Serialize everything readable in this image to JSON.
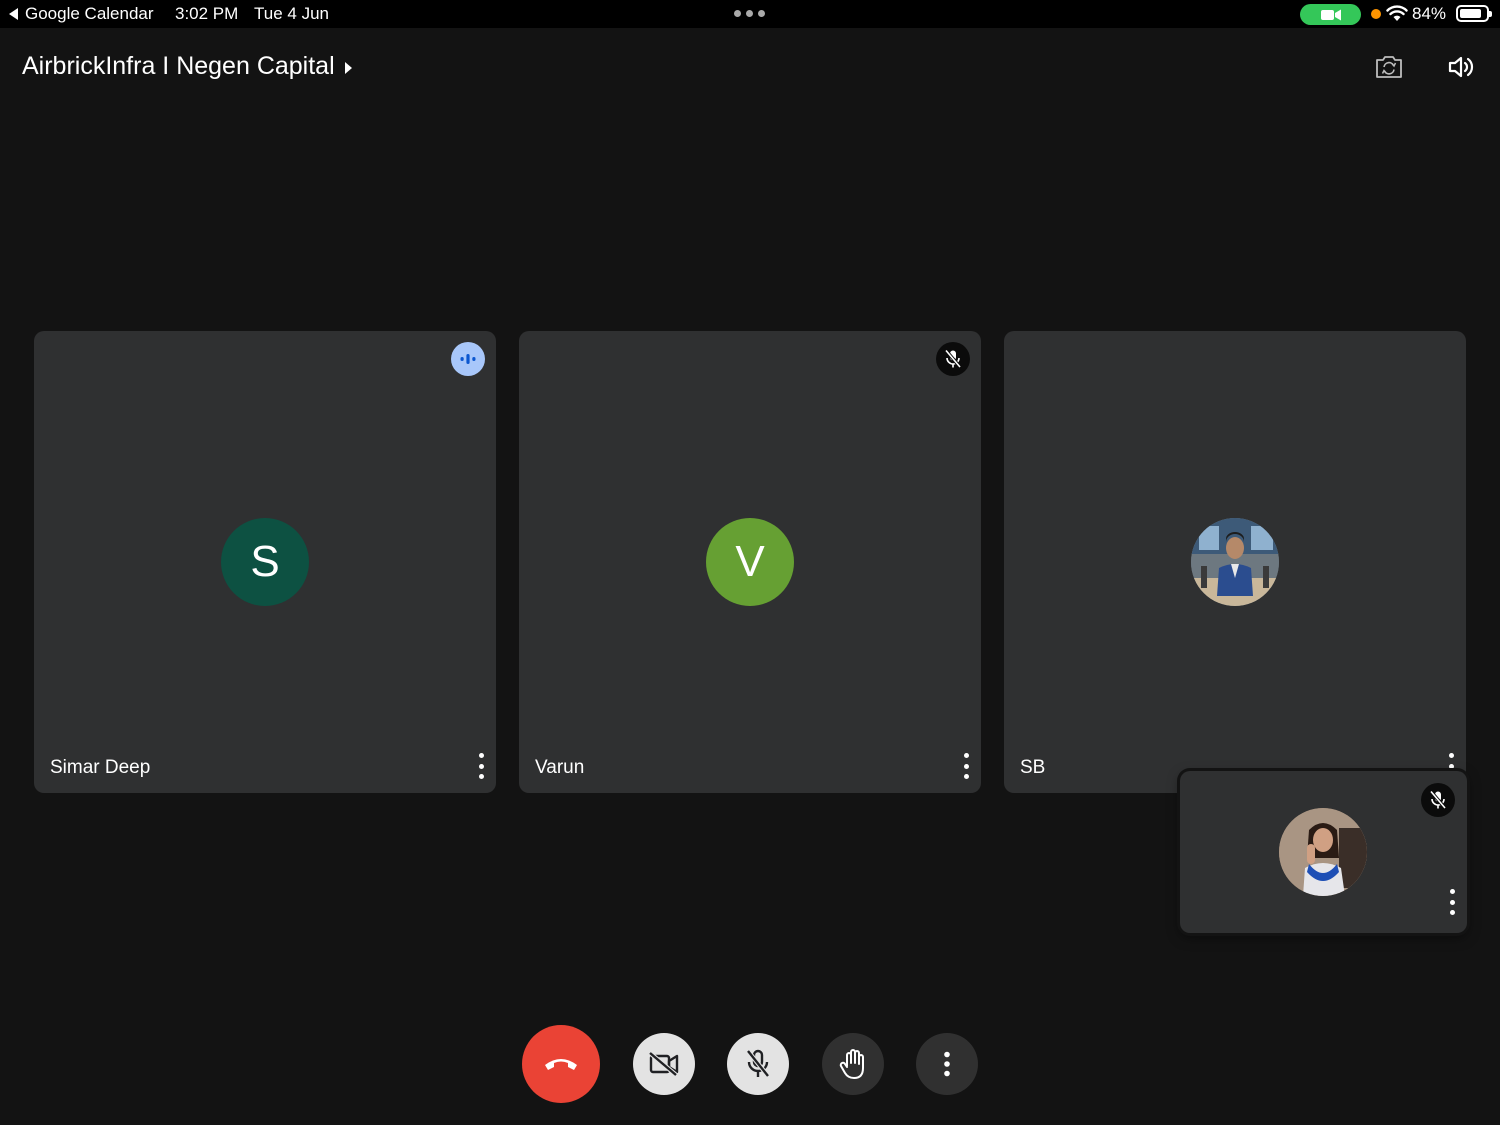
{
  "status_bar": {
    "back_app": "Google Calendar",
    "time": "3:02 PM",
    "date": "Tue 4 Jun",
    "battery": "84%",
    "battery_level": 0.84,
    "icons": [
      "multitask-dots-icon",
      "camera-in-use-icon",
      "privacy-dot-icon",
      "wifi-icon",
      "battery-icon"
    ]
  },
  "header": {
    "title": "AirbrickInfra I Negen Capital",
    "icons": [
      "switch-camera-icon",
      "speaker-icon"
    ]
  },
  "participants": [
    {
      "name": "Simar Deep",
      "initial": "S",
      "avatar_color": "#0d5142",
      "status": "speaking",
      "status_icon": "audio-level-icon"
    },
    {
      "name": "Varun",
      "initial": "V",
      "avatar_color": "#66a033",
      "status": "muted",
      "status_icon": "mic-off-icon"
    },
    {
      "name": "SB",
      "initial": "",
      "avatar": "profile-photo",
      "status": "",
      "status_icon": ""
    }
  ],
  "self_view": {
    "avatar": "profile-photo",
    "status": "muted",
    "status_icon": "mic-off-icon"
  },
  "controls": [
    {
      "id": "leave",
      "icon": "hang-up-icon",
      "color": "#ea4335"
    },
    {
      "id": "camera",
      "icon": "camera-off-icon",
      "color": "#e3e3e3"
    },
    {
      "id": "mic",
      "icon": "mic-off-icon",
      "color": "#e3e3e3"
    },
    {
      "id": "hand",
      "icon": "raise-hand-icon",
      "color": "#303030"
    },
    {
      "id": "more",
      "icon": "more-options-icon",
      "color": "#303030"
    }
  ]
}
